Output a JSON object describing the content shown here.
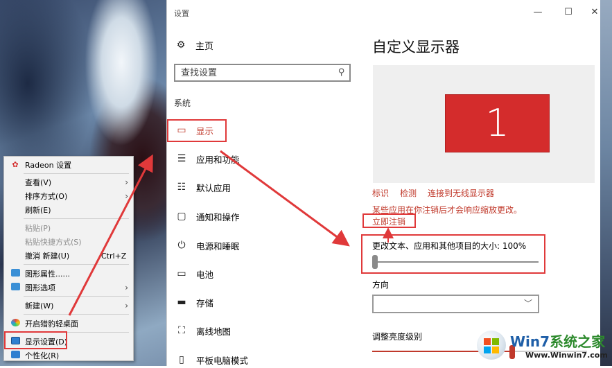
{
  "window": {
    "title": "设置",
    "controls": {
      "minimize": "—",
      "maximize": "☐",
      "close": "✕"
    }
  },
  "nav": {
    "home_label": "主页",
    "search_placeholder": "查找设置",
    "section_label": "系统",
    "items": [
      {
        "label": "显示",
        "icon": "monitor-icon",
        "active": true
      },
      {
        "label": "应用和功能",
        "icon": "list-icon"
      },
      {
        "label": "默认应用",
        "icon": "default-apps-icon"
      },
      {
        "label": "通知和操作",
        "icon": "notification-icon"
      },
      {
        "label": "电源和睡眠",
        "icon": "power-icon"
      },
      {
        "label": "电池",
        "icon": "battery-icon"
      },
      {
        "label": "存储",
        "icon": "storage-icon"
      },
      {
        "label": "离线地图",
        "icon": "map-icon"
      },
      {
        "label": "平板电脑模式",
        "icon": "tablet-icon"
      }
    ]
  },
  "content": {
    "title": "自定义显示器",
    "monitor_number": "1",
    "links": [
      "标识",
      "检测",
      "连接到无线显示器"
    ],
    "note": "某些应用在你注销后才会响应缩放更改。",
    "signout_link": "立即注销",
    "scale_label": "更改文本、应用和其他项目的大小: 100%",
    "scale_value_percent": 100,
    "orientation_label": "方向",
    "orientation_value": "",
    "brightness_label": "调整亮度级别"
  },
  "context_menu": {
    "items": [
      {
        "label": "Radeon 设置",
        "icon": "radeon-icon"
      },
      {
        "label": "查看(V)",
        "submenu": true
      },
      {
        "label": "排序方式(O)",
        "submenu": true
      },
      {
        "label": "刷新(E)"
      },
      {
        "label": "粘贴(P)",
        "disabled": true
      },
      {
        "label": "粘贴快捷方式(S)",
        "disabled": true
      },
      {
        "label": "撤消 新建(U)",
        "shortcut": "Ctrl+Z"
      },
      {
        "label": "图形属性......",
        "icon": "graphics-icon"
      },
      {
        "label": "图形选项",
        "icon": "graphics-icon",
        "submenu": true
      },
      {
        "label": "新建(W)",
        "submenu": true
      },
      {
        "label": "开启猎豹轻桌面",
        "icon": "cheetah-icon"
      },
      {
        "label": "显示设置(D)",
        "icon": "display-settings-icon"
      },
      {
        "label": "个性化(R)",
        "icon": "personalize-icon"
      }
    ]
  },
  "watermark": {
    "title_a": "Win7",
    "title_b": "系统之家",
    "url": "Www.Winwin7.com"
  },
  "colors": {
    "accent": "#c0392b",
    "highlight_box": "#e0393a",
    "monitor_fill": "#d42c2c"
  }
}
